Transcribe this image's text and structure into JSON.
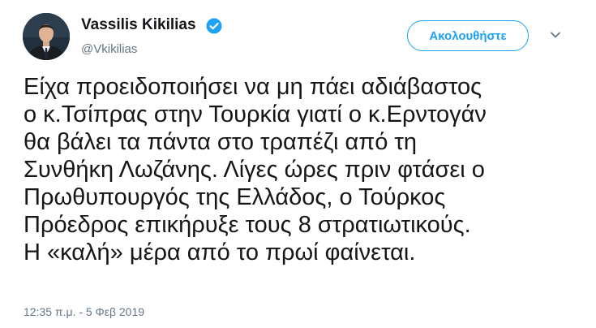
{
  "author": {
    "name": "Vassilis Kikilias",
    "handle": "@Vkikilias",
    "verified": true,
    "avatar_icon": "profile-photo-man-in-suit"
  },
  "actions": {
    "follow_label": "Ακολουθήστε",
    "more_icon": "chevron-down-icon"
  },
  "tweet": {
    "lines": [
      "Είχα προειδοποιήσει να μη πάει αδιάβαστος",
      "ο κ.Τσίπρας στην Τουρκία γιατί ο κ.Ερντογάν",
      "θα βάλει τα πάντα στο τραπέζι από τη",
      "Συνθήκη Λωζάνης. Λίγες ώρες πριν φτάσει ο",
      "Πρωθυπουργός της Ελλάδος, ο Τούρκος",
      "Πρόεδρος επικήρυξε τους 8 στρατιωτικούς.",
      "Η «καλή» μέρα από το πρωί φαίνεται."
    ],
    "timestamp": "12:35 π.μ. - 5 Φεβ 2019"
  },
  "colors": {
    "accent": "#1da1f2",
    "text": "#14171a",
    "secondary_text": "#657786"
  }
}
